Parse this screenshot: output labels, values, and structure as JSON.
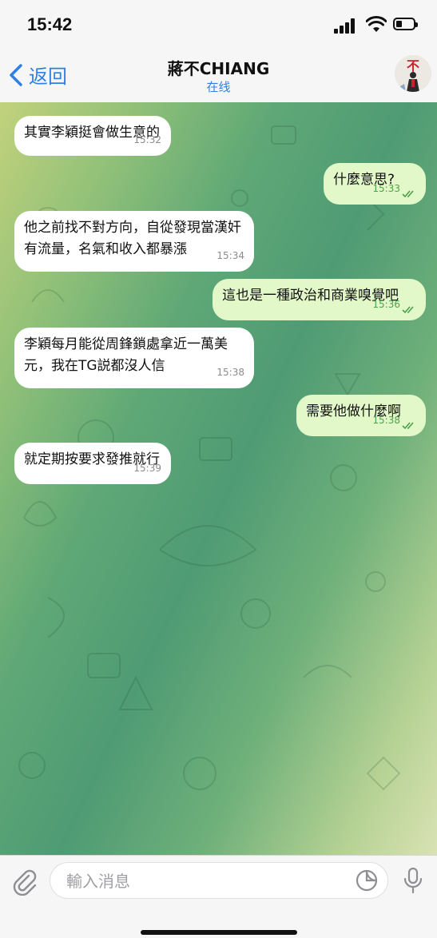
{
  "status_bar": {
    "time": "15:42"
  },
  "header": {
    "back_label": "返回",
    "title": "蔣不CHIANG",
    "status": "在线",
    "avatar_text": "不"
  },
  "messages": [
    {
      "dir": "in",
      "text": "其實李穎挺會做生意的",
      "time": "15:32"
    },
    {
      "dir": "out",
      "text": "什麼意思?",
      "time": "15:33"
    },
    {
      "dir": "in",
      "text": "他之前找不對方向，自從發現當漢奸有流量，名氣和收入都暴漲",
      "time": "15:34"
    },
    {
      "dir": "out",
      "text": "這也是一種政治和商業嗅覺吧",
      "time": "15:36"
    },
    {
      "dir": "in",
      "text": "李穎每月能從周鋒鎖處拿近一萬美元，我在TG説都沒人信",
      "time": "15:38"
    },
    {
      "dir": "out",
      "text": "需要他做什麼啊",
      "time": "15:38"
    },
    {
      "dir": "in",
      "text": "就定期按要求發推就行",
      "time": "15:39"
    }
  ],
  "composer": {
    "placeholder": "輸入消息"
  },
  "icons": {
    "back": "chevron-left-icon",
    "attach": "paperclip-icon",
    "sticker": "sticker-icon",
    "mic": "microphone-icon",
    "read": "double-check-icon"
  },
  "colors": {
    "accent": "#2f7fe6",
    "outgoing_bubble": "#e3f8c9",
    "read_check": "#4ca24a"
  }
}
